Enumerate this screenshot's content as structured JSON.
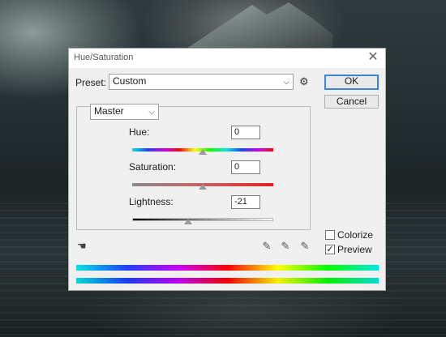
{
  "dialog": {
    "title": "Hue/Saturation",
    "close_symbol": "✕"
  },
  "preset": {
    "label": "Preset:",
    "value": "Custom",
    "options_icon": "gear-icon"
  },
  "buttons": {
    "ok": "OK",
    "cancel": "Cancel"
  },
  "channel": {
    "value": "Master"
  },
  "adjustments": {
    "hue": {
      "label": "Hue:",
      "value": "0",
      "min": -180,
      "max": 180
    },
    "saturation": {
      "label": "Saturation:",
      "value": "0",
      "min": -100,
      "max": 100
    },
    "lightness": {
      "label": "Lightness:",
      "value": "-21",
      "min": -100,
      "max": 100
    }
  },
  "options": {
    "colorize": {
      "label": "Colorize",
      "checked": false
    },
    "preview": {
      "label": "Preview",
      "checked": true
    }
  },
  "icons": {
    "targeted_adjustment": "hand-scrubber-icon",
    "eyedroppers": [
      "eyedropper-icon",
      "eyedropper-plus-icon",
      "eyedropper-minus-icon"
    ]
  },
  "colors": {
    "accent": "#3c82d8",
    "dialog_bg": "#f0f0f0"
  }
}
